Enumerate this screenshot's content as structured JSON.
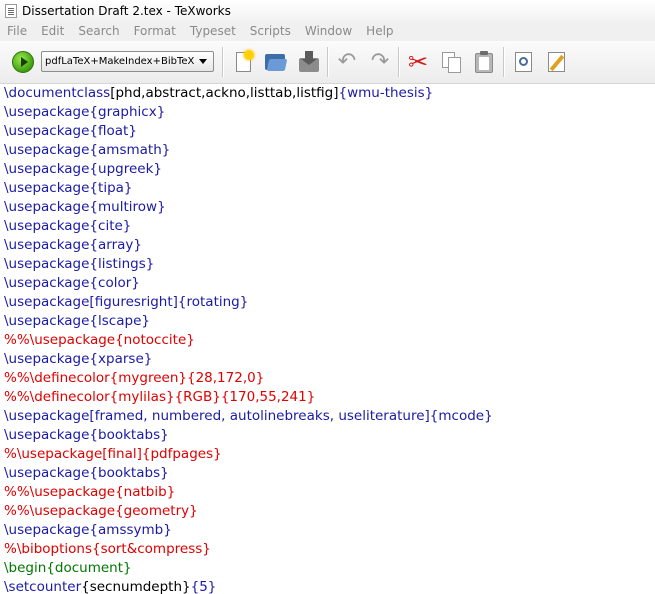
{
  "window": {
    "title": "Dissertation Draft 2.tex - TeXworks"
  },
  "menu": [
    "File",
    "Edit",
    "Search",
    "Format",
    "Typeset",
    "Scripts",
    "Window",
    "Help"
  ],
  "toolbar": {
    "engine": "pdfLaTeX+MakeIndex+BibTeX"
  },
  "colors": {
    "command": "#1a1aa6",
    "text": "#000000",
    "comment": "#e00000",
    "environment": "#007700"
  },
  "editor": {
    "lines": [
      [
        [
          "cmd",
          "\\documentclass"
        ],
        [
          "txt",
          "[phd,abstract,ackno,listtab,listfig]"
        ],
        [
          "cmd",
          "{wmu-thesis}"
        ]
      ],
      [
        [
          "cmd",
          "\\usepackage{graphicx}"
        ]
      ],
      [
        [
          "cmd",
          "\\usepackage{float}"
        ]
      ],
      [
        [
          "cmd",
          "\\usepackage{amsmath}"
        ]
      ],
      [
        [
          "cmd",
          "\\usepackage{upgreek}"
        ]
      ],
      [
        [
          "cmd",
          "\\usepackage{tipa}"
        ]
      ],
      [
        [
          "cmd",
          "\\usepackage{multirow}"
        ]
      ],
      [
        [
          "cmd",
          "\\usepackage{cite}"
        ]
      ],
      [
        [
          "cmd",
          "\\usepackage{array}"
        ]
      ],
      [
        [
          "cmd",
          "\\usepackage{listings}"
        ]
      ],
      [
        [
          "cmd",
          "\\usepackage{color}"
        ]
      ],
      [
        [
          "cmd",
          "\\usepackage[figuresright]{rotating}"
        ]
      ],
      [
        [
          "cmd",
          "\\usepackage{lscape}"
        ]
      ],
      [
        [
          "com",
          "%%\\usepackage{notoccite}"
        ]
      ],
      [
        [
          "cmd",
          "\\usepackage{xparse}"
        ]
      ],
      [
        [
          "com",
          "%%\\definecolor{mygreen}{28,172,0}"
        ]
      ],
      [
        [
          "com",
          "%%\\definecolor{mylilas}{RGB}{170,55,241}"
        ]
      ],
      [
        [
          "cmd",
          "\\usepackage[framed, numbered, autolinebreaks, useliterature]{mcode}"
        ]
      ],
      [
        [
          "cmd",
          "\\usepackage{booktabs}"
        ]
      ],
      [
        [
          "com",
          "%\\usepackage[final]{pdfpages}"
        ]
      ],
      [
        [
          "cmd",
          "\\usepackage{booktabs}"
        ]
      ],
      [
        [
          "com",
          "%%\\usepackage{natbib}"
        ]
      ],
      [
        [
          "com",
          "%%\\usepackage{geometry}"
        ]
      ],
      [
        [
          "cmd",
          "\\usepackage{amssymb}"
        ]
      ],
      [
        [
          "com",
          "%\\biboptions{sort&compress}"
        ]
      ],
      [
        [
          "env",
          "\\begin{document}"
        ]
      ],
      [
        [
          "cmd",
          "\\setcounter"
        ],
        [
          "txt",
          "{secnumdepth}"
        ],
        [
          "cmd",
          "{5}"
        ]
      ]
    ]
  }
}
